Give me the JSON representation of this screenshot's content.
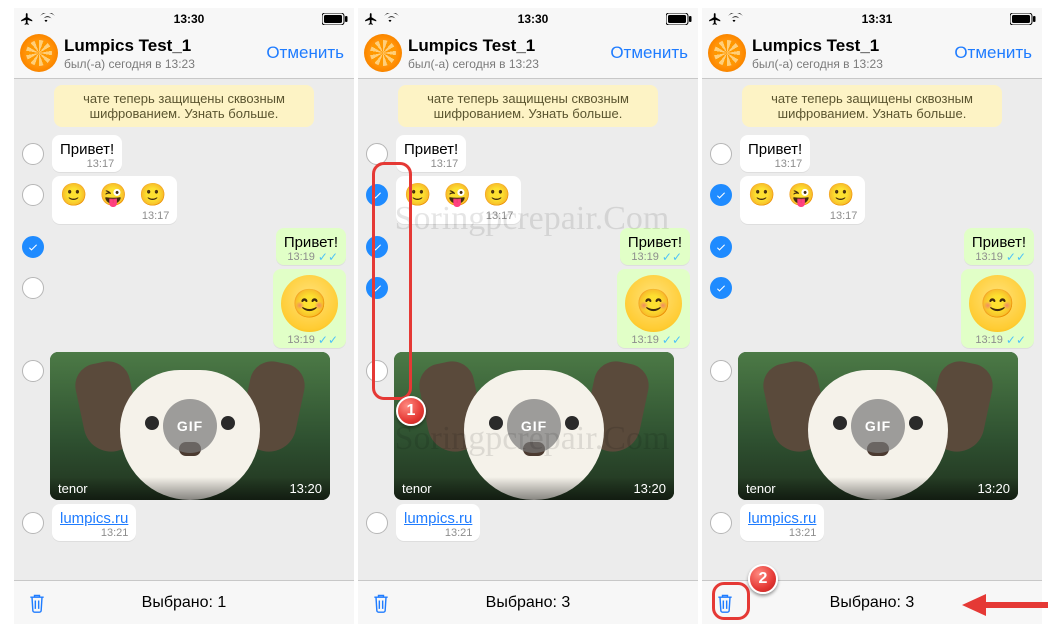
{
  "watermark": "Soringpcrepair.Com",
  "statusbar_times": [
    "13:30",
    "13:30",
    "13:31"
  ],
  "chat_name": "Lumpics Test_1",
  "chat_sub": "был(-а) сегодня в 13:23",
  "cancel": "Отменить",
  "notice": "чате теперь защищены сквозным шифрованием. Узнать больше.",
  "msgs": {
    "m1": "Привет!",
    "m2_emoji": "🙂 😜 🙂",
    "m3": "Привет!",
    "gif_label": "GIF",
    "gif_source": "tenor",
    "link": "lumpics.ru"
  },
  "times": {
    "t1317": "13:17",
    "t1319": "13:19",
    "t1320": "13:20",
    "t1321": "13:21"
  },
  "bottom": {
    "label_prefix": "Выбрано: ",
    "counts": [
      "1",
      "3",
      "3"
    ]
  },
  "selection": [
    [
      false,
      false,
      true,
      false,
      false,
      false
    ],
    [
      false,
      true,
      true,
      true,
      false,
      false
    ],
    [
      false,
      true,
      true,
      true,
      false,
      false
    ]
  ],
  "callouts": {
    "n1": "1",
    "n2": "2"
  }
}
